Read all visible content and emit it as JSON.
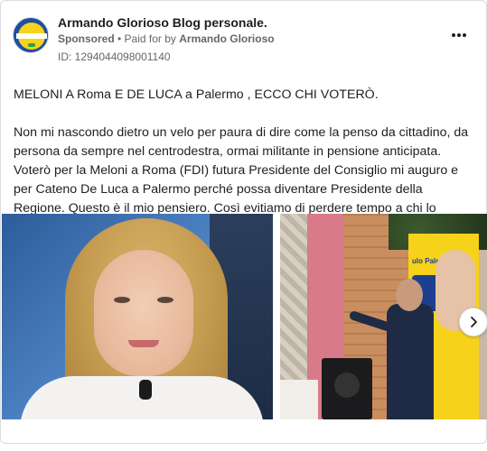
{
  "ad": {
    "page_name": "Armando Glorioso Blog personale.",
    "sponsored_label": "Sponsored",
    "separator": " • ",
    "paid_for_prefix": "Paid for by ",
    "advertiser": "Armando Glorioso",
    "id_label": "ID: 1294044098001140",
    "more_icon": "more-horizontal-icon"
  },
  "post": {
    "headline": "MELONI A Roma E DE LUCA a Palermo , ECCO CHI VOTERÒ.",
    "body": "Non mi nascondo dietro un velo per paura di dire come la penso da cittadino, da persona da sempre nel centrodestra, ormai militante in pensione anticipata. Voterò per la Meloni a Roma (FDI) futura Presidente del Consiglio mi auguro e per Cateno De Luca a Palermo perché possa diventare Presidente della Regione. Questo è il mio pensiero. Così evitiamo di perdere tempo a chi lo voleva sapere...."
  },
  "carousel": {
    "next_icon": "chevron-right-icon",
    "poster_text": "ulo Palermo"
  },
  "colors": {
    "text_primary": "#1c1e21",
    "text_secondary": "#65676b",
    "border": "#dadde1",
    "avatar_blue": "#1c4fa1",
    "avatar_yellow": "#f7d21c",
    "poster_yellow": "#f6d21a"
  }
}
